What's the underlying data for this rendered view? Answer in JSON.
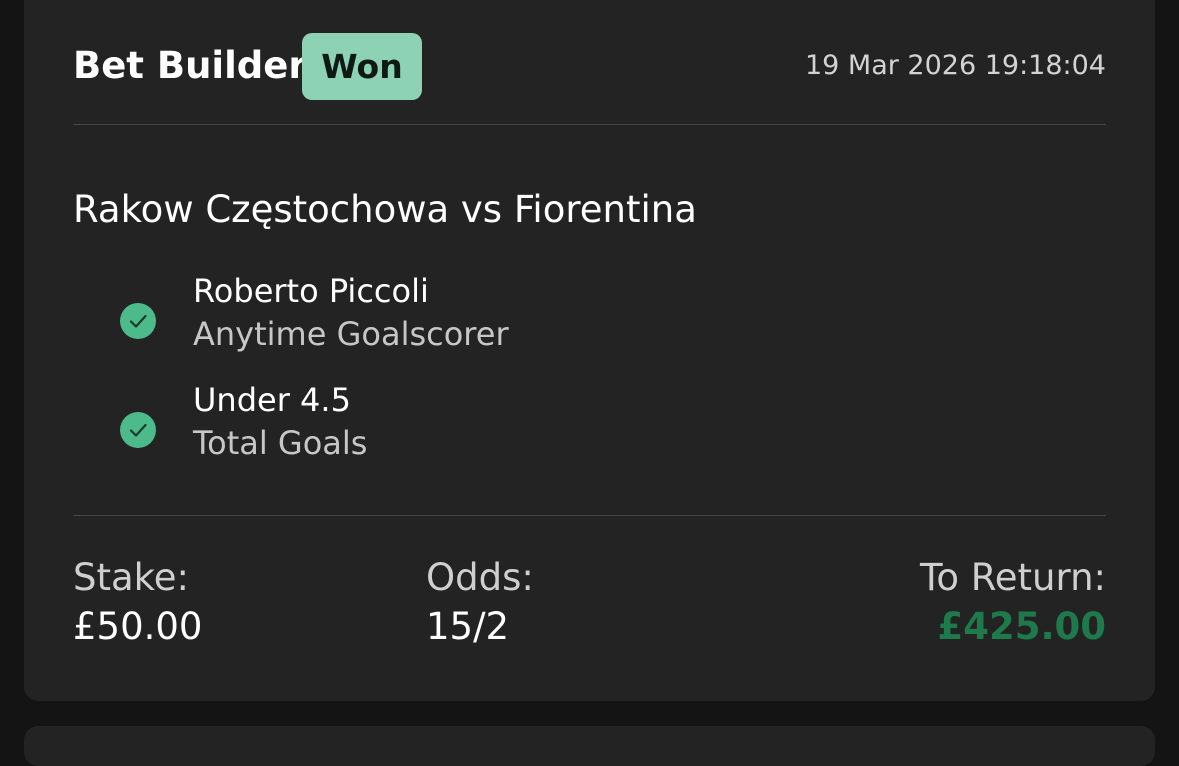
{
  "bet": {
    "type": "Bet Builder",
    "status": "Won",
    "placed_at": "19 Mar 2026 19:18:04",
    "event": "Rakow Częstochowa vs Fiorentina",
    "selections": [
      {
        "name": "Roberto Piccoli",
        "market": "Anytime Goalscorer",
        "result_icon": "check-circle-icon"
      },
      {
        "name": "Under 4.5",
        "market": "Total Goals",
        "result_icon": "check-circle-icon"
      }
    ],
    "stake_label": "Stake:",
    "stake_value": "£50.00",
    "odds_label": "Odds:",
    "odds_value": "15/2",
    "return_label": "To Return:",
    "return_value": "£425.00"
  },
  "colors": {
    "won_badge": "#8dd2b4",
    "check": "#4dba8c",
    "return_amount": "#1e7a4a",
    "card": "#232323",
    "background": "#141414"
  }
}
